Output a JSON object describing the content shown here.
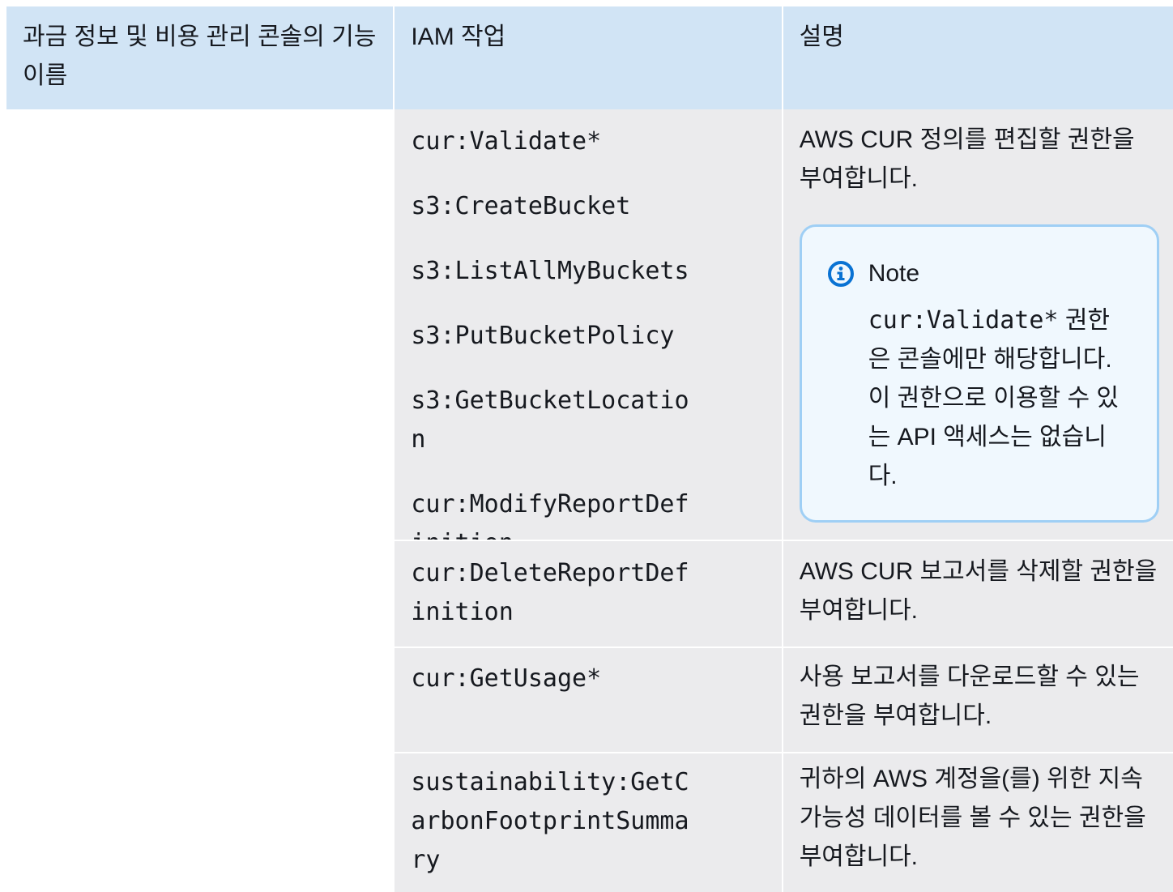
{
  "table": {
    "headers": {
      "feature": "과금 정보 및 비용 관리 콘솔의 기능 이름",
      "iam_action": "IAM 작업",
      "description": "설명"
    },
    "rows": [
      {
        "feature": "",
        "actions": [
          "cur:Validate*",
          "s3:CreateBucket",
          "s3:ListAllMyBuckets",
          "s3:PutBucketPolicy",
          "s3:GetBucketLocation",
          "cur:ModifyReportDefinition"
        ],
        "description": "AWS CUR 정의를 편집할 권한을 부여합니다.",
        "note": {
          "title": "Note",
          "code": "cur:Validate*",
          "text": " 권한은 콘솔에만 해당합니다. 이 권한으로 이용할 수 있는 API 액세스는 없습니다."
        }
      },
      {
        "feature": "",
        "actions": [
          "cur:DeleteReportDefinition"
        ],
        "description": "AWS CUR 보고서를 삭제할 권한을 부여합니다."
      },
      {
        "feature": "",
        "actions": [
          "cur:GetUsage*"
        ],
        "description": "사용 보고서를 다운로드할 수 있는 권한을 부여합니다."
      },
      {
        "feature": "",
        "actions": [
          "sustainability:GetCarbonFootprintSummary"
        ],
        "description": "귀하의 AWS 계정을(를) 위한 지속 가능성 데이터를 볼 수 있는 권한을 부여합니다."
      }
    ]
  },
  "icons": {
    "note": "info-circle-icon"
  },
  "colors": {
    "header_bg": "#d1e4f5",
    "cell_bg": "#ebebed",
    "note_border": "#9fcff5",
    "note_bg": "#f0f8fe",
    "info_icon": "#0972d3"
  }
}
